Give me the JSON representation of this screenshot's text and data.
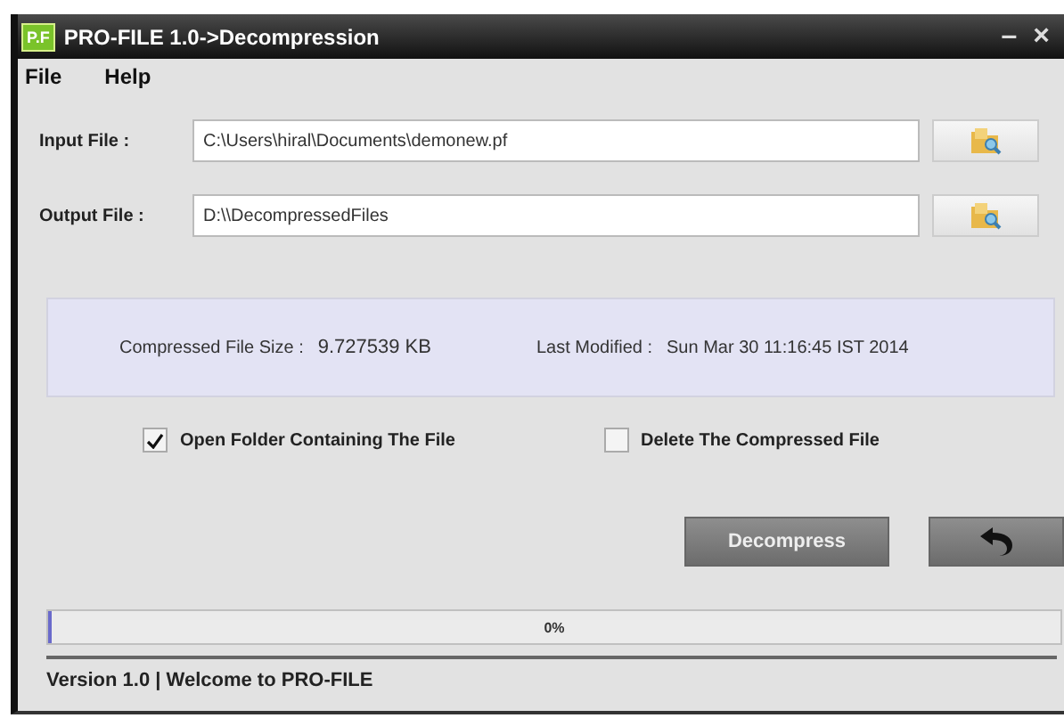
{
  "window": {
    "logo": "P.F",
    "title": "PRO-FILE 1.0->Decompression",
    "minimize": "–",
    "close": "×"
  },
  "menu": [
    "File",
    "Help"
  ],
  "fields": [
    {
      "label": "Input File :",
      "value": "C:\\Users\\hiral\\Documents\\demonew.pf"
    },
    {
      "label": "Output File :",
      "value": "D:\\\\DecompressedFiles"
    }
  ],
  "info": [
    {
      "label": "Compressed File Size :",
      "value": "9.727539 KB"
    },
    {
      "label": "Last Modified :",
      "value": "Sun Mar 30 11:16:45 IST 2014"
    }
  ],
  "options": [
    {
      "label": "Open Folder Containing The File",
      "checked": true
    },
    {
      "label": "Delete The Compressed File",
      "checked": false
    }
  ],
  "buttons": {
    "primary": "Decompress"
  },
  "progress": {
    "level": 0,
    "text": "0%"
  },
  "status_bar": "Version 1.0 | Welcome to PRO-FILE"
}
